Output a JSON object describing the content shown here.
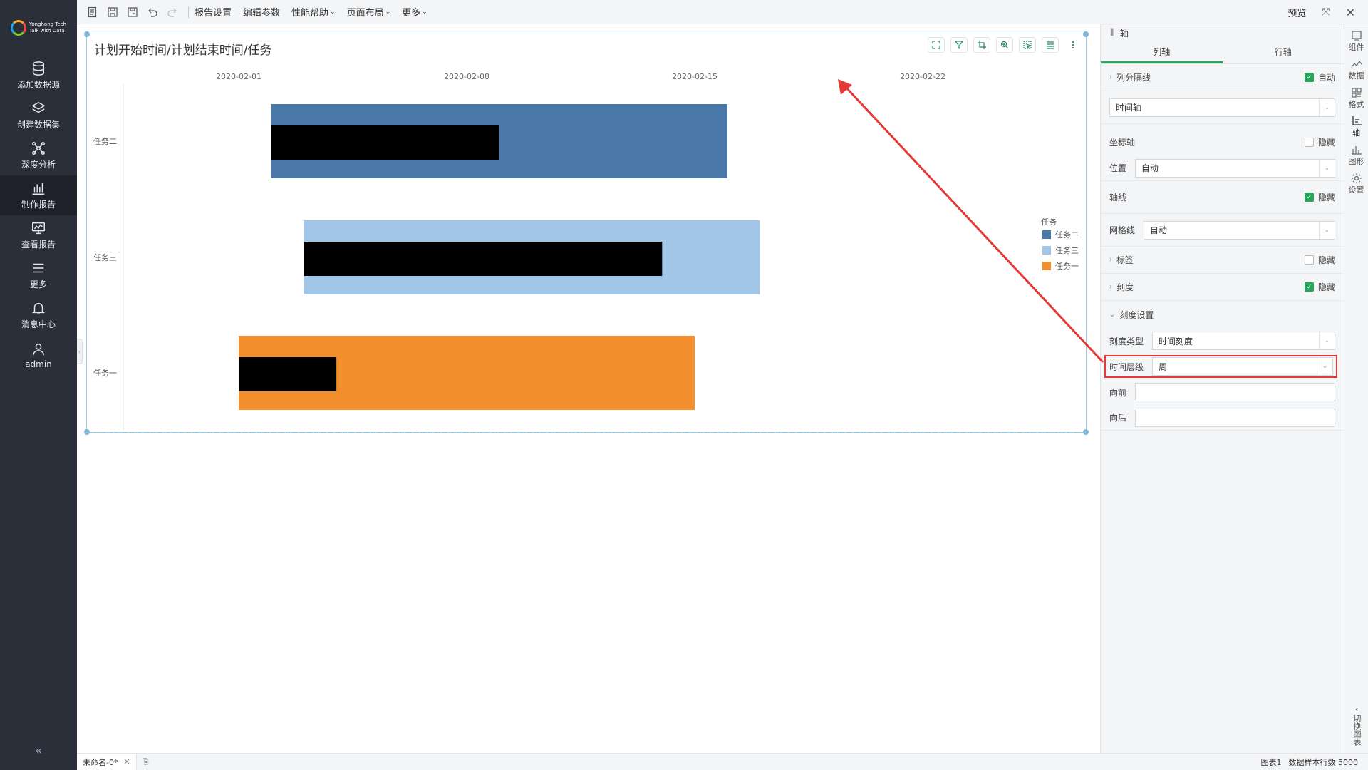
{
  "nav": {
    "brand_line1": "Yonghong Tech",
    "brand_line2": "Talk with Data",
    "items": [
      {
        "label": "添加数据源",
        "icon": "database-icon"
      },
      {
        "label": "创建数据集",
        "icon": "layers-icon"
      },
      {
        "label": "深度分析",
        "icon": "network-icon"
      },
      {
        "label": "制作报告",
        "icon": "bar-chart-icon",
        "active": true
      },
      {
        "label": "查看报告",
        "icon": "monitor-icon"
      },
      {
        "label": "更多",
        "icon": "menu-icon"
      },
      {
        "label": "消息中心",
        "icon": "bell-icon"
      },
      {
        "label": "admin",
        "icon": "user-icon"
      }
    ],
    "collapse": "«"
  },
  "toolbar": {
    "menus": [
      "报告设置",
      "编辑参数",
      "性能帮助",
      "页面布局",
      "更多"
    ],
    "preview": "预览"
  },
  "chart": {
    "title": "计划开始时间/计划结束时间/任务",
    "legend_title": "任务",
    "legend": [
      {
        "label": "任务二",
        "color": "#4a78a8"
      },
      {
        "label": "任务三",
        "color": "#a1c6e7"
      },
      {
        "label": "任务一",
        "color": "#f28e2b"
      }
    ]
  },
  "chart_data": {
    "type": "gantt",
    "x_ticks": [
      "2020-02-01",
      "2020-02-08",
      "2020-02-15",
      "2020-02-22"
    ],
    "categories": [
      "任务二",
      "任务三",
      "任务一"
    ],
    "bars": [
      {
        "task": "任务二",
        "start": "2020-02-02",
        "end": "2020-02-16",
        "color": "#4a78a8"
      },
      {
        "task": "任务三",
        "start": "2020-02-03",
        "end": "2020-02-17",
        "color": "#a1c6e7"
      },
      {
        "task": "任务一",
        "start": "2020-02-01",
        "end": "2020-02-15",
        "color": "#f28e2b"
      }
    ],
    "redacted": [
      {
        "task": "任务二",
        "start": "2020-02-02",
        "end": "2020-02-09"
      },
      {
        "task": "任务三",
        "start": "2020-02-03",
        "end": "2020-02-14"
      },
      {
        "task": "任务一",
        "start": "2020-02-01",
        "end": "2020-02-04"
      }
    ],
    "time_level": "周"
  },
  "panel": {
    "header": "轴",
    "tabs": [
      "列轴",
      "行轴"
    ],
    "col_divider": "列分隔线",
    "auto": "自动",
    "timeaxis": "时间轴",
    "axis": "坐标轴",
    "hide": "隐藏",
    "position_label": "位置",
    "position_value": "自动",
    "axisline": "轴线",
    "gridline_label": "网格线",
    "gridline_value": "自动",
    "tag": "标签",
    "scale": "刻度",
    "scale_settings": "刻度设置",
    "scale_type_label": "刻度类型",
    "scale_type_value": "时间刻度",
    "time_level_label": "时间层级",
    "time_level_value": "周",
    "forward_label": "向前",
    "backward_label": "向后"
  },
  "strip": {
    "items": [
      {
        "label": "组件",
        "icon": "component-icon"
      },
      {
        "label": "数据",
        "icon": "data-icon"
      },
      {
        "label": "格式",
        "icon": "format-icon"
      },
      {
        "label": "轴",
        "icon": "axis-icon"
      },
      {
        "label": "图形",
        "icon": "shape-icon"
      },
      {
        "label": "设置",
        "icon": "settings-icon"
      }
    ],
    "switch": "切换图表"
  },
  "status": {
    "tab": "未命名-0*",
    "chart": "图表1",
    "rows": "数据样本行数 5000"
  }
}
